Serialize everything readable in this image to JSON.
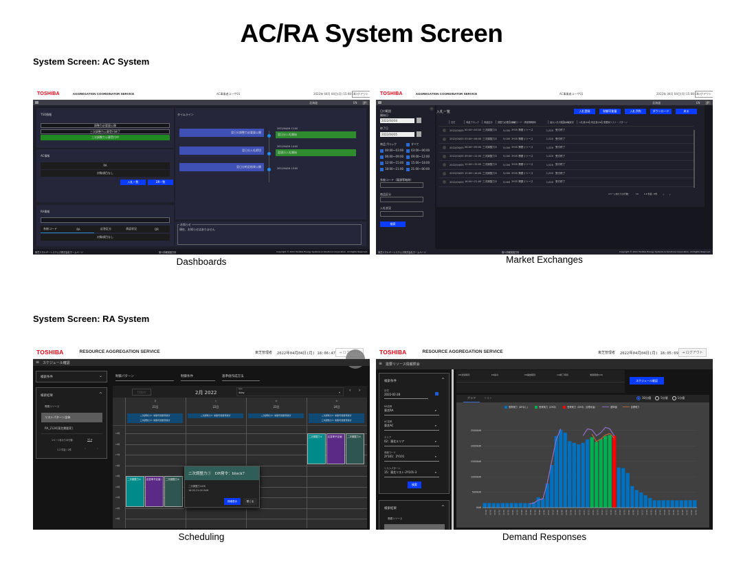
{
  "page_title": "AC/RA System Screen",
  "sections": {
    "ac": "System Screen: AC System",
    "ra": "System Screen: RA System"
  },
  "captions": {
    "dashboards": "Dashboards",
    "market": "Market Exchanges",
    "scheduling": "Scheduling",
    "demand": "Demand Responses"
  },
  "colors": {
    "toshiba_red": "#e60012",
    "primary_blue": "#0a3cff",
    "green": "#1f8a1f",
    "dr_green": "#00b050",
    "dr_red": "#ff0000",
    "bar_blue": "#0070c0"
  },
  "dashboard": {
    "logo": "TOSHIBA",
    "service": "AGGREGATION COORDINATOR SERVICE",
    "user": "AC事業者ユーザ01",
    "datetime": "2022年 04月 04日(月) 15:08:56",
    "logout": "ログアウト",
    "region": "北海道",
    "lang_en": "EN",
    "lang_jp": "JP",
    "tso": {
      "label": "TSO情報",
      "items": [
        "調整力必要量公開",
        "三次調整力公募受付終了",
        "三次調整力公募受付中"
      ]
    },
    "ac": {
      "label": "AC情報",
      "ra_label": "RA",
      "empty": "対象項目なし",
      "btn_bid": "入札一覧",
      "btn_dr": "DR一覧"
    },
    "ra": {
      "label": "RA情報",
      "cols": [
        "系統コード",
        "RA",
        "応答区分",
        "承認状況",
        "DR"
      ],
      "empty": "対象項目なし"
    },
    "timeline": {
      "label": "タイムライン",
      "left": [
        "翌日分調整力必要量公開",
        "翌日分入札締切",
        "翌日分約定結果公開"
      ],
      "right": [
        {
          "time": "2022/04/04 12:00",
          "event": "翌日分入札開始"
        },
        {
          "time": "2022/04/04 14:00",
          "event": "翌週分入札開始"
        },
        {
          "time": "2022/04/04 15:00",
          "event": ""
        }
      ]
    },
    "notice": {
      "label": "お知らせ",
      "text": "現在、お知らせはありません"
    },
    "footer": {
      "left": "東芝エネルギーシステムズ株式会社ホームページ",
      "mid": "個人情報保護方針",
      "right": "Copyright © 2021 Toshiba Energy Systems & Solutions Corporation. All Rights Reserved."
    }
  },
  "market": {
    "logo": "TOSHIBA",
    "service": "AGGREGATION COORDINATOR SERVICE",
    "user": "AC事業者ユーザ01",
    "datetime": "2022年 04月 04日(月) 15:08:59",
    "logout": "ログアウト",
    "region": "北海道",
    "lang_en": "EN",
    "lang_jp": "JP",
    "filter": {
      "date_range": "日付範囲",
      "start_label": "開始日",
      "start_value": "2022/04/04",
      "end_label": "終了日",
      "end_value": "2022/04/05",
      "block_label": "商品ブロック",
      "all": "すべて",
      "blocks": [
        "00:00〜03:00",
        "03:00〜06:00",
        "06:00〜09:00",
        "09:00〜12:00",
        "12:00〜15:00",
        "15:00〜18:00",
        "18:00〜21:00",
        "21:00〜00:00"
      ],
      "grid_code": "系統コード（電源等略称）",
      "product": "商品区分",
      "bid_status": "入札状況",
      "search": "検索"
    },
    "list_title": "入札一覧",
    "actions": [
      "入札登録",
      "制御可能量",
      "入札予約",
      "ダウンロード",
      "戻る"
    ],
    "columns": [
      "日付",
      "商品ブロック",
      "商品区分",
      "調整力必要量(kW)",
      "系統コード（電源等略称）",
      "最大入札可能量(kW)",
      "入札状況",
      "入札量(kW)",
      "約定量(kW)",
      "需要家リスト・パターン"
    ],
    "rows": [
      [
        "2022/04/05",
        "00:00〜03:00",
        "三次調整力②",
        "5,000",
        "3Y05 需要リソース",
        "1,020",
        "受付終了"
      ],
      [
        "2022/04/05",
        "03:00〜06:00",
        "三次調整力②",
        "5,000",
        "3Y05 需要リソース",
        "1,020",
        "受付終了"
      ],
      [
        "2022/04/05",
        "06:00〜09:00",
        "三次調整力②",
        "5,000",
        "3Y05 需要リソース",
        "1,020",
        "受付終了"
      ],
      [
        "2022/04/05",
        "09:00〜12:00",
        "三次調整力②",
        "5,000",
        "3Y05 需要リソース",
        "1,020",
        "受付終了"
      ],
      [
        "2022/04/05",
        "12:00〜15:00",
        "三次調整力②",
        "5,000",
        "3Y05 需要リソース",
        "1,020",
        "受付終了"
      ],
      [
        "2022/04/05",
        "15:00〜18:00",
        "三次調整力②",
        "5,000",
        "3Y05 需要リソース",
        "1,020",
        "受付終了"
      ],
      [
        "2022/04/05",
        "18:00〜21:00",
        "三次調整力②",
        "5,000",
        "3Y05 需要リソース",
        "1,020",
        "受付終了"
      ]
    ],
    "pager": {
      "per_page_label": "1ページあたりの行数：",
      "per_page": "10",
      "range": "1-8 件目 / 8件"
    },
    "footer": {
      "left": "東芝エネルギーシステムズ株式会社ホームページ",
      "mid": "個人情報保護方針",
      "right": "Copyright © 2021 Toshiba Energy Systems & Solutions Corporation. All Rights Reserved."
    }
  },
  "scheduling": {
    "logo": "TOSHIBA",
    "service": "RESOURCE AGGREGATION SERVICE",
    "user": "東芝管理者",
    "datetime": "2022年04月04日(月) 18:06:47",
    "logout": "ログアウト",
    "page": "スケジュール確認",
    "search_cond": "検索条件",
    "search_result": "検索結果",
    "resource_label": "需要リソース",
    "list_items": [
      "リストパターン全体",
      "RA_2124[東芝需要家]"
    ],
    "per_page_label": "1ページあたりの行数：",
    "per_page": "20",
    "range": "1-2 件目 / 2件",
    "tabs": [
      "制御パターン",
      "制御条件",
      "基準値作成方法"
    ],
    "today": "TODAY",
    "month": "2月 2022",
    "type_label": "type",
    "type_value": "4day",
    "days": [
      {
        "dow": "月",
        "date": "21日",
        "tags": [
          "二次調整力①: 制御可能量登録済",
          "三次調整力②: 制御可能量登録済"
        ]
      },
      {
        "dow": "火",
        "date": "22日",
        "tags": [
          "二次調整力①: 制御可能量登録済"
        ]
      },
      {
        "dow": "水",
        "date": "23日",
        "tags": [
          "二次調整力①: 制御可能量登録済"
        ]
      },
      {
        "dow": "木",
        "date": "24日",
        "tags": [
          "二次調整力①: 制御可能量登録済",
          "三次調整力②: 制御可能量登録済"
        ]
      }
    ],
    "hours": [
      "15時",
      "16時",
      "17時",
      "18時",
      "19時",
      "20時",
      "21時",
      "22時",
      "23時"
    ],
    "events": [
      "二次調整力①",
      "応答率予定値 :",
      "二次調整力①"
    ],
    "popup": {
      "title": "二次調整力①　DR発令：block7",
      "line1": "二次調整力①DR",
      "line2": "18:00-21:00 0kW",
      "detail": "詳細表示",
      "close": "閉じる"
    }
  },
  "demand": {
    "logo": "TOSHIBA",
    "service": "RESOURCE AGGREGATION SERVICE",
    "user": "東芝管理者",
    "datetime": "2022年04月04日(月) 18:05:09",
    "logout": "ログアウト",
    "page": "需要リソース情報照会",
    "search_cond": "検索条件",
    "fields": [
      {
        "label": "日付",
        "value": "2022-02-28"
      },
      {
        "label": "RA名称",
        "value": "東芝RA"
      },
      {
        "label": "AC名称",
        "value": "東芝AC"
      },
      {
        "label": "エリア",
        "value": "02：東北エリア"
      },
      {
        "label": "系統コード",
        "value": "2Y101：2Y101"
      },
      {
        "label": "リストパターン",
        "value": "15：東芝リスト-2Y101-3"
      }
    ],
    "search": "検索",
    "result": "検索結果",
    "resource_label": "需要リソース",
    "info_cols": [
      "DR通知時刻",
      "DR指令",
      "DR開始時刻",
      "DR終了時刻",
      "制御容量[kW]"
    ],
    "schedule_btn": "スケジュール確認",
    "tabs": [
      "グラフ",
      "リスト"
    ],
    "intervals": [
      {
        "label": "30分値",
        "selected": true
      },
      {
        "label": "5分値",
        "selected": false
      },
      {
        "label": "1分値",
        "selected": false
      }
    ]
  },
  "chart_data": {
    "type": "bar",
    "title": "",
    "xlabel": "",
    "ylabel": "",
    "ylim": [
      0,
      25000
    ],
    "yticks": [
      "0kW",
      "5000kW",
      "10000kW",
      "15000kW",
      "20000kW",
      "25000kW"
    ],
    "legend": [
      {
        "name": "受電電力（DRなし）",
        "color": "#0070c0",
        "kind": "bar"
      },
      {
        "name": "受電電力（DR中）",
        "color": "#00b050",
        "kind": "bar"
      },
      {
        "name": "受電電力（DR中、目標未達）",
        "color": "#ff0000",
        "kind": "bar"
      },
      {
        "name": "基準値",
        "color": "#8e6bbf",
        "kind": "line"
      },
      {
        "name": "目標電力",
        "color": "#b5643a",
        "kind": "line"
      }
    ],
    "legend_position": "top",
    "categories": [
      "00:00",
      "00:30",
      "01:00",
      "01:30",
      "02:00",
      "02:30",
      "03:00",
      "03:30",
      "04:00",
      "04:30",
      "05:00",
      "05:30",
      "06:00",
      "06:30",
      "07:00",
      "07:30",
      "08:00",
      "08:30",
      "09:00",
      "09:30",
      "10:00",
      "10:30",
      "11:00",
      "11:30",
      "12:00",
      "12:30",
      "13:00",
      "13:30",
      "14:00",
      "14:30",
      "15:00",
      "15:30",
      "16:00",
      "16:30",
      "17:00",
      "17:30",
      "18:00",
      "18:30",
      "19:00",
      "19:30",
      "20:00",
      "20:30",
      "21:00",
      "21:30",
      "22:00",
      "22:30",
      "23:00",
      "23:30"
    ],
    "values": [
      1500,
      1500,
      1450,
      1450,
      1500,
      1500,
      1500,
      1500,
      1500,
      1450,
      1450,
      1800,
      3300,
      3000,
      7800,
      13800,
      23200,
      25200,
      24300,
      21500,
      21000,
      20500,
      21000,
      22100,
      22800,
      21300,
      22200,
      23200,
      23500,
      23300,
      13000,
      12800,
      11200,
      7000,
      5700,
      4900,
      4000,
      3100,
      2400,
      2400,
      2400,
      2400,
      2400,
      2400,
      2400,
      2400,
      2400,
      2400
    ],
    "bar_status": [
      "n",
      "n",
      "n",
      "n",
      "n",
      "n",
      "n",
      "n",
      "n",
      "n",
      "n",
      "n",
      "n",
      "n",
      "n",
      "n",
      "n",
      "n",
      "n",
      "n",
      "n",
      "n",
      "n",
      "n",
      "g",
      "g",
      "g",
      "g",
      "g",
      "r",
      "n",
      "n",
      "n",
      "n",
      "n",
      "n",
      "n",
      "n",
      "n",
      "n",
      "n",
      "n",
      "n",
      "n",
      "n",
      "n",
      "n",
      "n"
    ],
    "series_lines": [
      {
        "name": "基準値",
        "start_index": 10,
        "values": [
          1200,
          1500,
          2500,
          2800,
          8000,
          15000,
          22000,
          25500
        ]
      },
      {
        "name": "基準値",
        "start_index": 22,
        "values": [
          23300,
          25500,
          25200,
          23300,
          24300,
          26000,
          25500,
          23200
        ]
      },
      {
        "name": "目標電力",
        "start_index": 24,
        "values": [
          23800,
          21400,
          22200,
          23500,
          24000,
          22500
        ]
      }
    ]
  }
}
